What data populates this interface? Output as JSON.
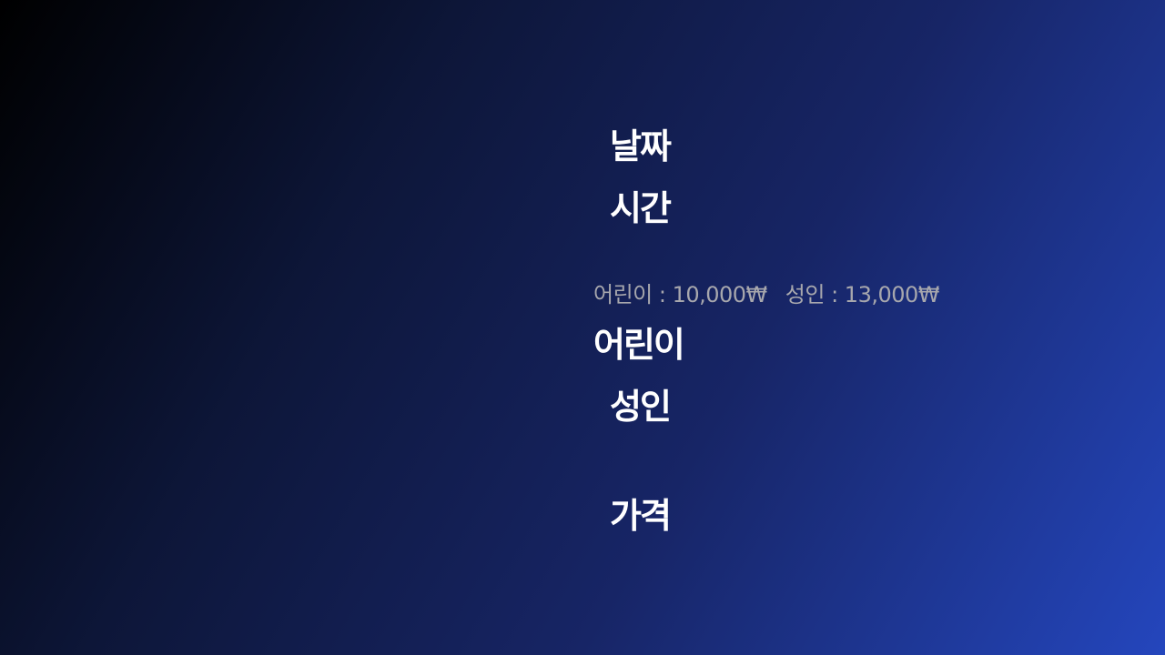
{
  "form": {
    "date_label": "날짜",
    "time_label": "시간",
    "price_info": {
      "child": "어린이 : 10,000₩",
      "adult": "성인 : 13,000₩"
    },
    "child_label": "어린이",
    "adult_label": "성인",
    "total_label": "가격"
  },
  "colors": {
    "background_start": "#000000",
    "background_end": "#2446bd",
    "label_text": "#ffffff",
    "price_info_text": "#a7a7ad"
  }
}
